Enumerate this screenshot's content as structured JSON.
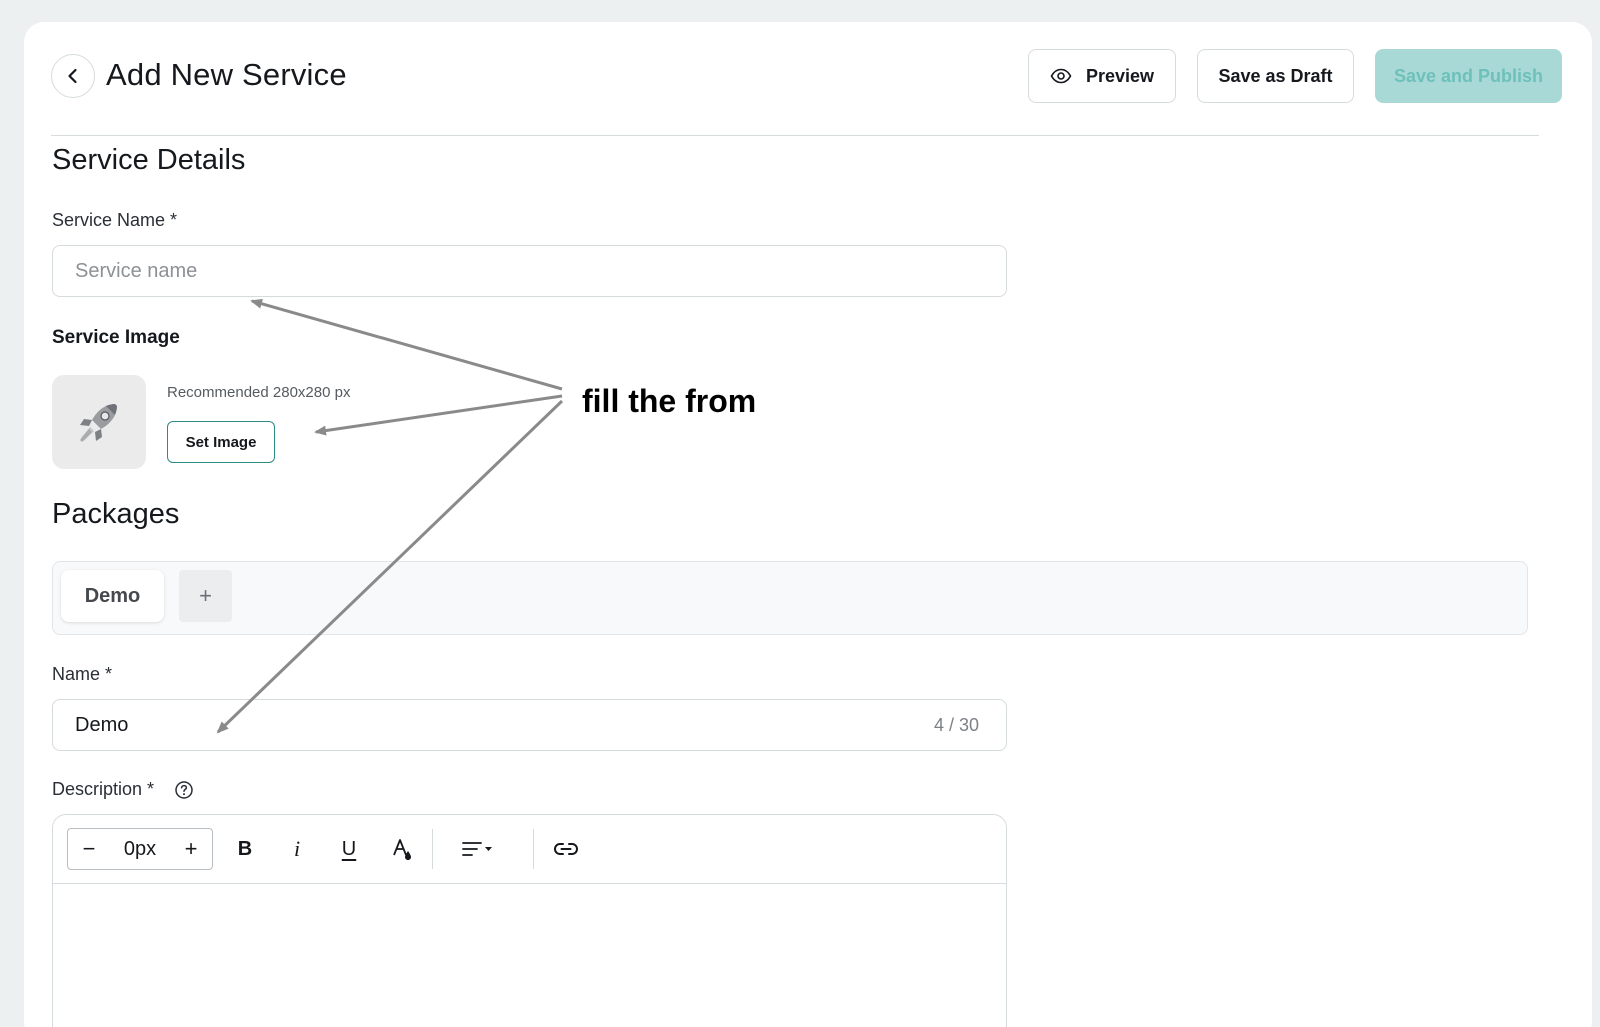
{
  "header": {
    "title": "Add New Service",
    "preview_label": "Preview",
    "draft_label": "Save as Draft",
    "publish_label": "Save and Publish"
  },
  "service_details": {
    "section_title": "Service Details",
    "name_label": "Service Name *",
    "name_placeholder": "Service name",
    "image_label": "Service Image",
    "image_recommend": "Recommended 280x280 px",
    "set_image_label": "Set Image",
    "image_icon": "rocket-icon"
  },
  "packages": {
    "section_title": "Packages",
    "tabs": [
      {
        "label": "Demo"
      }
    ],
    "add_tab_label": "+",
    "name_label": "Name *",
    "name_value": "Demo",
    "name_counter": "4 / 30",
    "description_label": "Description *"
  },
  "editor": {
    "font_size_value": "0px",
    "minus_label": "−",
    "plus_label": "+",
    "bold_label": "B",
    "italic_label": "i",
    "underline_label": "U"
  },
  "annotation": {
    "text": "fill the from",
    "arrow_color": "#8a8a8a"
  },
  "colors": {
    "accent": "#2d8a86",
    "publish_bg": "#a8d9d6",
    "publish_text": "#6ec0bb"
  }
}
